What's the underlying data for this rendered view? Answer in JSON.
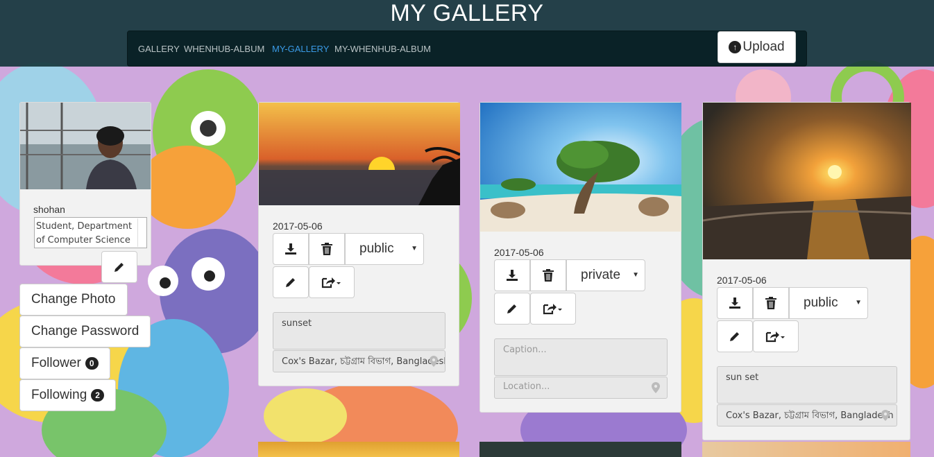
{
  "header": {
    "title": "MY GALLERY"
  },
  "nav": {
    "items": [
      {
        "label": "GALLERY"
      },
      {
        "label": "WHENHUB-ALBUM"
      },
      {
        "label": "MY-GALLERY"
      },
      {
        "label": "MY-WHENHUB-ALBUM"
      }
    ],
    "active": "MY-GALLERY",
    "upload_label": "Upload",
    "active_color": "#3a9ae6"
  },
  "profile": {
    "username": "shohan",
    "bio": "Student, Department of Computer Science",
    "buttons": {
      "change_photo": "Change Photo",
      "change_password": "Change Password",
      "follower": "Follower",
      "following": "Following"
    },
    "follower_count": "0",
    "following_count": "2"
  },
  "photos": [
    {
      "date": "2017-05-06",
      "privacy": "public",
      "caption": "sunset",
      "location": "Cox's Bazar, চট্টগ্রাম বিভাগ, Bangladesh",
      "image": "sunset over sea with palm"
    },
    {
      "date": "2017-05-06",
      "privacy": "private",
      "caption": "",
      "caption_placeholder": "Caption...",
      "location": "",
      "location_placeholder": "Location...",
      "image": "tree on beach"
    },
    {
      "date": "2017-05-06",
      "privacy": "public",
      "caption": "sun set",
      "location": "Cox's Bazar, চট্টগ্রাম বিভাগ, Bangladesh",
      "image": "sunset over beach"
    }
  ],
  "icons": [
    "upload-icon",
    "download-icon",
    "trash-icon",
    "pencil-icon",
    "share-icon",
    "map-pin-icon"
  ]
}
